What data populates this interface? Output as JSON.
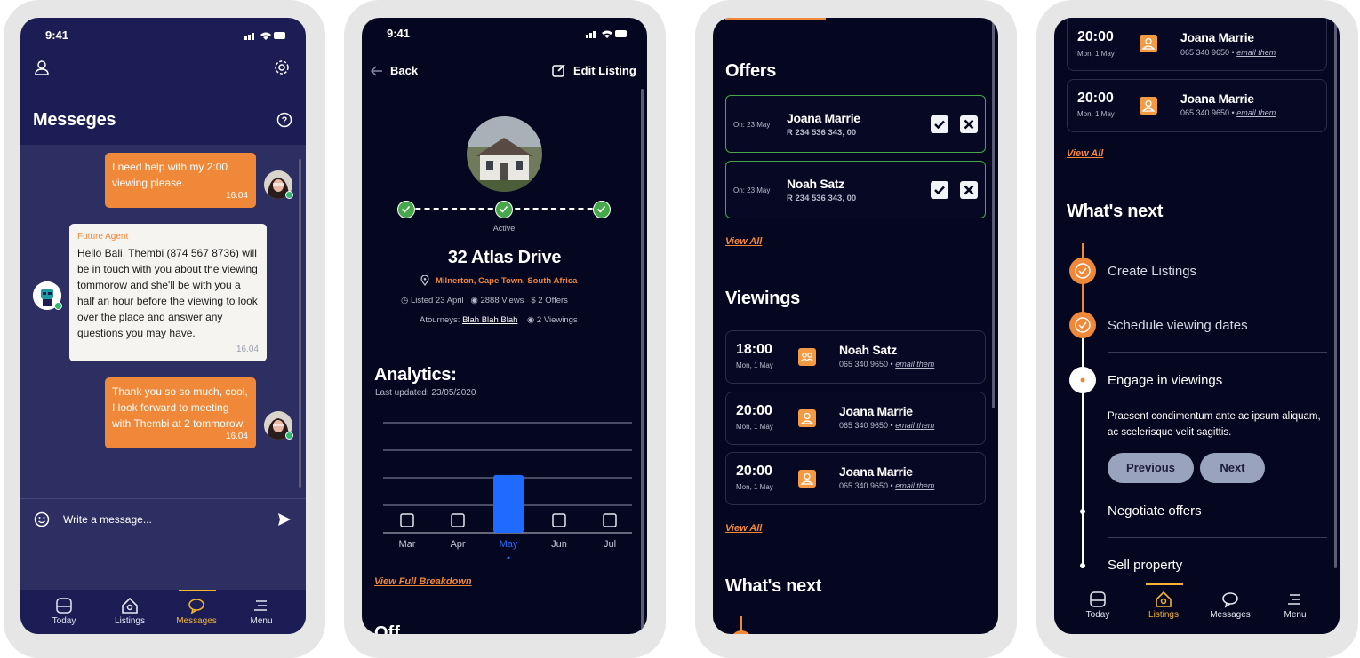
{
  "status": {
    "time": "9:41"
  },
  "messages_screen": {
    "title": "Messeges",
    "bubbles": {
      "out1": {
        "text": "I need help with my 2:00 viewing please.",
        "time": "16.04"
      },
      "in1": {
        "sender": "Future Agent",
        "text": "Hello Bali, Thembi (874 567 8736) will be in touch with you about the viewing tommorow and she'll be with you a half an hour before the viewing to look over the place and answer any questions you may have.",
        "time": "16.04"
      },
      "out2": {
        "text": "Thank you so so much, cool, I look forward to meeting with Thembi at 2 tommorow.",
        "time": "16.04"
      }
    },
    "input_placeholder": "Write a message...",
    "tabs": [
      "Today",
      "Listings",
      "Messages",
      "Menu"
    ]
  },
  "listing_screen": {
    "back": "Back",
    "edit": "Edit Listing",
    "status": "Active",
    "address": "32 Atlas Drive",
    "location": "Milnerton, Cape Town, South Africa",
    "listed": "Listed 23 April",
    "views": "2888 Views",
    "offers": "2 Offers",
    "attorneys_label": "Atourneys:",
    "attorneys": "Blah Blah Blah",
    "viewings": "2 Viewings",
    "analytics_title": "Analytics:",
    "updated": "Last updated: 23/05/2020",
    "view_breakdown": "View Full Breakdown",
    "next_title_partial": "Off"
  },
  "chart_data": {
    "type": "bar",
    "categories": [
      "Mar",
      "Apr",
      "May",
      "Jun",
      "Jul"
    ],
    "values": [
      null,
      null,
      2.1,
      null,
      null
    ],
    "highlight": "May",
    "ylim": [
      0,
      4
    ],
    "grid": true
  },
  "offers_screen": {
    "offers_title": "Offers",
    "offers": [
      {
        "date": "On: 23 May",
        "name": "Joana Marrie",
        "amount": "R 234 536 343, 00"
      },
      {
        "date": "On: 23 May",
        "name": "Noah Satz",
        "amount": "R 234 536 343, 00"
      }
    ],
    "view_all": "View All",
    "viewings_title": "Viewings",
    "viewings": [
      {
        "time": "18:00",
        "date": "Mon, 1 May",
        "name": "Noah Satz",
        "phone": "065 340 9650 •",
        "email": "email them",
        "icon": "group-icon"
      },
      {
        "time": "20:00",
        "date": "Mon, 1 May",
        "name": "Joana Marrie",
        "phone": "065 340 9650 •",
        "email": "email them",
        "icon": "person-icon"
      },
      {
        "time": "20:00",
        "date": "Mon, 1 May",
        "name": "Joana Marrie",
        "phone": "065 340 9650 •",
        "email": "email them",
        "icon": "person-icon"
      }
    ],
    "whats_next": "What's next"
  },
  "next_screen": {
    "viewings": [
      {
        "time": "20:00",
        "date": "Mon, 1 May",
        "name": "Joana Marrie",
        "phone": "065 340 9650 •",
        "email": "email them"
      },
      {
        "time": "20:00",
        "date": "Mon, 1 May",
        "name": "Joana Marrie",
        "phone": "065 340 9650 •",
        "email": "email them"
      }
    ],
    "view_all": "View All",
    "whats_next": "What's next",
    "steps": [
      "Create Listings",
      "Schedule viewing dates",
      "Engage in viewings",
      "Negotiate offers",
      "Sell property"
    ],
    "step_desc": "Praesent condimentum ante ac ipsum aliquam, ac scelerisque velit sagittis.",
    "previous": "Previous",
    "next": "Next",
    "tabs": [
      "Today",
      "Listings",
      "Messages",
      "Menu"
    ]
  },
  "colors": {
    "accent": "#f0883a",
    "tab_active": "#f3b333",
    "bar": "#1f6bff",
    "success": "#46a84a"
  }
}
